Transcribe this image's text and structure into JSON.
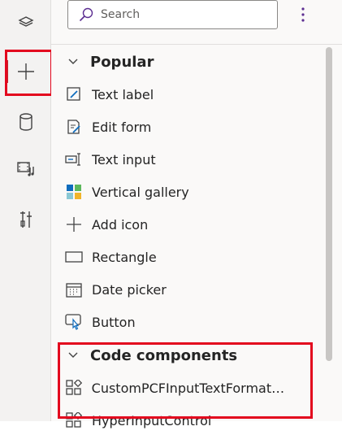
{
  "search": {
    "placeholder": "Search"
  },
  "sections": {
    "popular": {
      "title": "Popular",
      "items": [
        {
          "label": "Text label",
          "icon": "text-label-icon"
        },
        {
          "label": "Edit form",
          "icon": "edit-form-icon"
        },
        {
          "label": "Text input",
          "icon": "text-input-icon"
        },
        {
          "label": "Vertical gallery",
          "icon": "vertical-gallery-icon"
        },
        {
          "label": "Add icon",
          "icon": "add-icon-icon"
        },
        {
          "label": "Rectangle",
          "icon": "rectangle-icon"
        },
        {
          "label": "Date picker",
          "icon": "date-picker-icon"
        },
        {
          "label": "Button",
          "icon": "button-icon"
        }
      ]
    },
    "code": {
      "title": "Code components",
      "items": [
        {
          "label": "CustomPCFInputTextFormatt...",
          "icon": "code-component-icon"
        },
        {
          "label": "HyperInputControl",
          "icon": "code-component-icon"
        }
      ]
    }
  },
  "colors": {
    "highlight": "#e3081e",
    "accent": "#0f6cbd"
  }
}
